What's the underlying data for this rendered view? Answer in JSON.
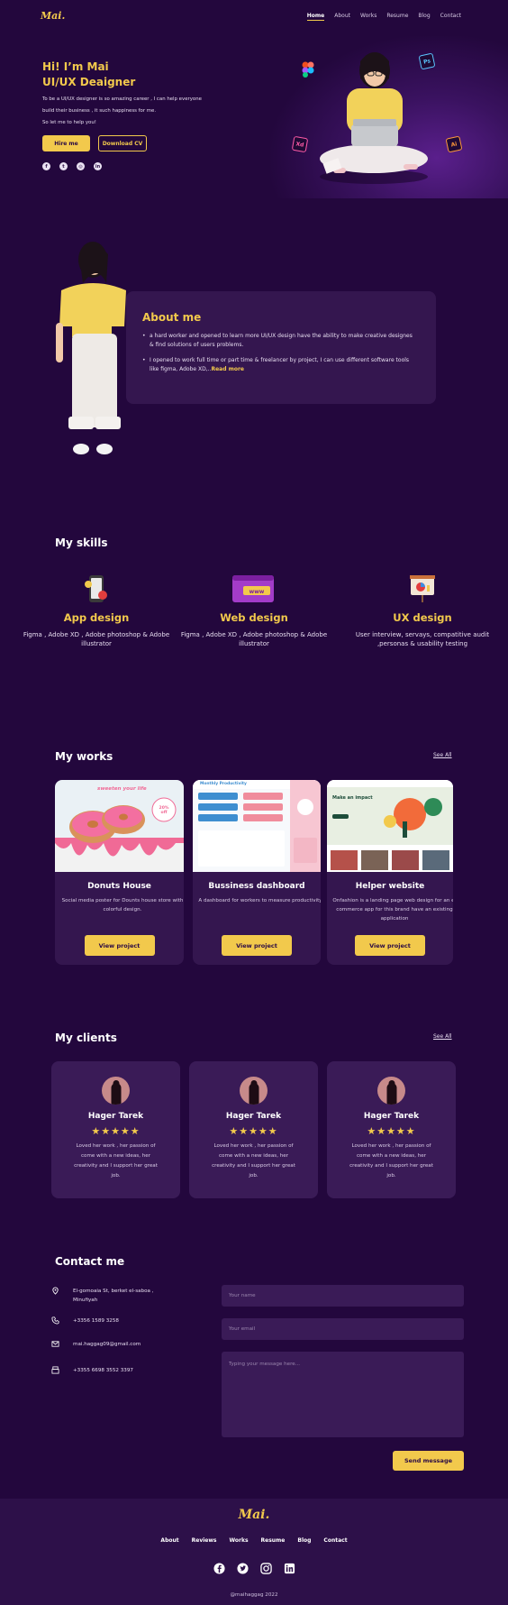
{
  "brand": {
    "logo": "Mai.",
    "accent": "#f2c94c",
    "background": "#23073d",
    "card": "#34164f"
  },
  "nav": [
    "Home",
    "About",
    "Works",
    "Resume",
    "Blog",
    "Contact"
  ],
  "hero": {
    "title_line1": "Hi! I’m Mai",
    "title_line2": "UI/UX Deaigner",
    "text_line1": "To be a UI/UX designer is so amazing career , I can help everyone",
    "text_line2": "build their business , it such happiness for me.",
    "text_line3": "So let me to help you!",
    "hire_label": "Hire me",
    "cv_label": "Download CV",
    "socials": [
      "facebook-icon",
      "twitter-icon",
      "instagram-icon",
      "linkedin-icon"
    ],
    "tool_icons": {
      "ps": "Ps",
      "xd": "Xd",
      "ai": "Ai"
    }
  },
  "about": {
    "title": "About me",
    "item1": "a hard worker and opened to learn more UI/UX design have the ability to make creative designes & find solutions of users problems.",
    "item2": "I opened to work full time  or part time & freelancer by project, I can use different software tools like figma, Adobe XD,..",
    "read_more": "Read more"
  },
  "skills": {
    "title": "My skills",
    "items": [
      {
        "title": "App design",
        "desc": "Figma , Adobe XD , Adobe photoshop & Adobe illustrator"
      },
      {
        "title": "Web design",
        "desc": "Figma , Adobe XD , Adobe photoshop & Adobe illustrator"
      },
      {
        "title": "UX design",
        "desc": "User interview, servays, compatitive audit ,personas & usability testing"
      }
    ]
  },
  "works": {
    "title": "My works",
    "see_all": "See All",
    "items": [
      {
        "title": "Donuts House",
        "desc": "Social media poster for Dounts house store with colorful design.",
        "button": "View project",
        "img_text": "sweeten your life",
        "img_badge": "20% off"
      },
      {
        "title": "Bussiness dashboard",
        "desc": "A dashboard for workers to measure productivity",
        "button": "View project",
        "img_text": "Monthly Productivity"
      },
      {
        "title": "Helper website",
        "desc": "Onfashion is a landing page web design for an e-commerce app for this brand have an existing application",
        "button": "View project",
        "img_text": "Make an impact"
      }
    ]
  },
  "clients": {
    "title": "My clients",
    "see_all": "See All",
    "items": [
      {
        "name": "Hager Tarek",
        "stars": "★★★★★",
        "text": "Loved her work , her passion  of come with a new ideas,  her creativity and I support her great job."
      },
      {
        "name": "Hager Tarek",
        "stars": "★★★★★",
        "text": "Loved her work , her passion  of come with a new ideas,  her creativity and I support her great job."
      },
      {
        "name": "Hager Tarek",
        "stars": "★★★★★",
        "text": "Loved her work , her passion  of come with a new ideas,  her creativity and I support her great job."
      }
    ]
  },
  "contact": {
    "title": "Contact me",
    "address_line1": "El-gomoaia St, berket el-saboa ,",
    "address_line2": "Minufiyah",
    "phone": "+3356 1589 3258",
    "email": "mai.haggag09@gmail.com",
    "fax": "+3355 6698 3552 3397",
    "name_placeholder": "Your name",
    "email_placeholder": "Your email",
    "message_placeholder": "Typing your message here...",
    "send_label": "Send message"
  },
  "footer": {
    "logo": "Mai.",
    "nav": [
      "About",
      "Reviews",
      "Works",
      "Resume",
      "Blog",
      "Contact"
    ],
    "socials": [
      "facebook-icon",
      "twitter-icon",
      "instagram-icon",
      "linkedin-icon"
    ],
    "copyright": "@maihaggag 2022"
  }
}
